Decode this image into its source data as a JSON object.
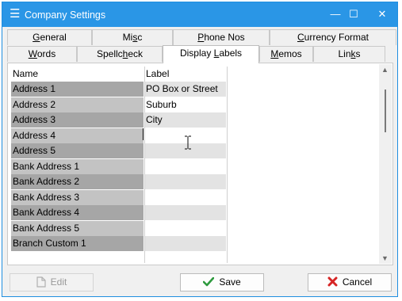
{
  "window": {
    "title": "Company Settings",
    "buttons": {
      "minimize": "—",
      "maximize": "☐",
      "close": "✕"
    }
  },
  "tabs_back": [
    {
      "name": "tab-general",
      "ul": "G",
      "rest": "eneral"
    },
    {
      "name": "tab-misc",
      "pre": "Mi",
      "ul": "s",
      "rest": "c"
    },
    {
      "name": "tab-phone-nos",
      "ul": "P",
      "rest": "hone Nos"
    },
    {
      "name": "tab-currency-format",
      "ul": "C",
      "rest": "urrency Format"
    }
  ],
  "tabs_front": [
    {
      "name": "tab-words",
      "ul": "W",
      "rest": "ords"
    },
    {
      "name": "tab-spellcheck",
      "pre": "Spellc",
      "ul": "h",
      "rest": "eck"
    },
    {
      "name": "tab-display-labels",
      "pre": "Display ",
      "ul": "L",
      "rest": "abels",
      "active": true
    },
    {
      "name": "tab-memos",
      "ul": "M",
      "rest": "emos"
    },
    {
      "name": "tab-links",
      "pre": "Lin",
      "ul": "k",
      "rest": "s"
    }
  ],
  "grid": {
    "headers": {
      "name": "Name",
      "label": "Label"
    },
    "rows": [
      {
        "name": "Address 1",
        "label": "PO Box or Street"
      },
      {
        "name": "Address 2",
        "label": "Suburb"
      },
      {
        "name": "Address 3",
        "label": "City"
      },
      {
        "name": "Address 4",
        "label": ""
      },
      {
        "name": "Address 5",
        "label": ""
      },
      {
        "name": "Bank Address 1",
        "label": ""
      },
      {
        "name": "Bank Address 2",
        "label": ""
      },
      {
        "name": "Bank Address 3",
        "label": ""
      },
      {
        "name": "Bank Address 4",
        "label": ""
      },
      {
        "name": "Bank Address 5",
        "label": ""
      },
      {
        "name": "Branch Custom 1",
        "label": ""
      }
    ]
  },
  "footer": {
    "edit_label": "Edit",
    "save_label": "Save",
    "cancel_label": "Cancel"
  },
  "colors": {
    "titlebar": "#2a96e6",
    "name_dark": "#a6a6a6",
    "name_light": "#c3c3c3",
    "label_alt": "#e3e3e3",
    "save_check": "#2e9a3e",
    "cancel_x": "#d62424"
  }
}
